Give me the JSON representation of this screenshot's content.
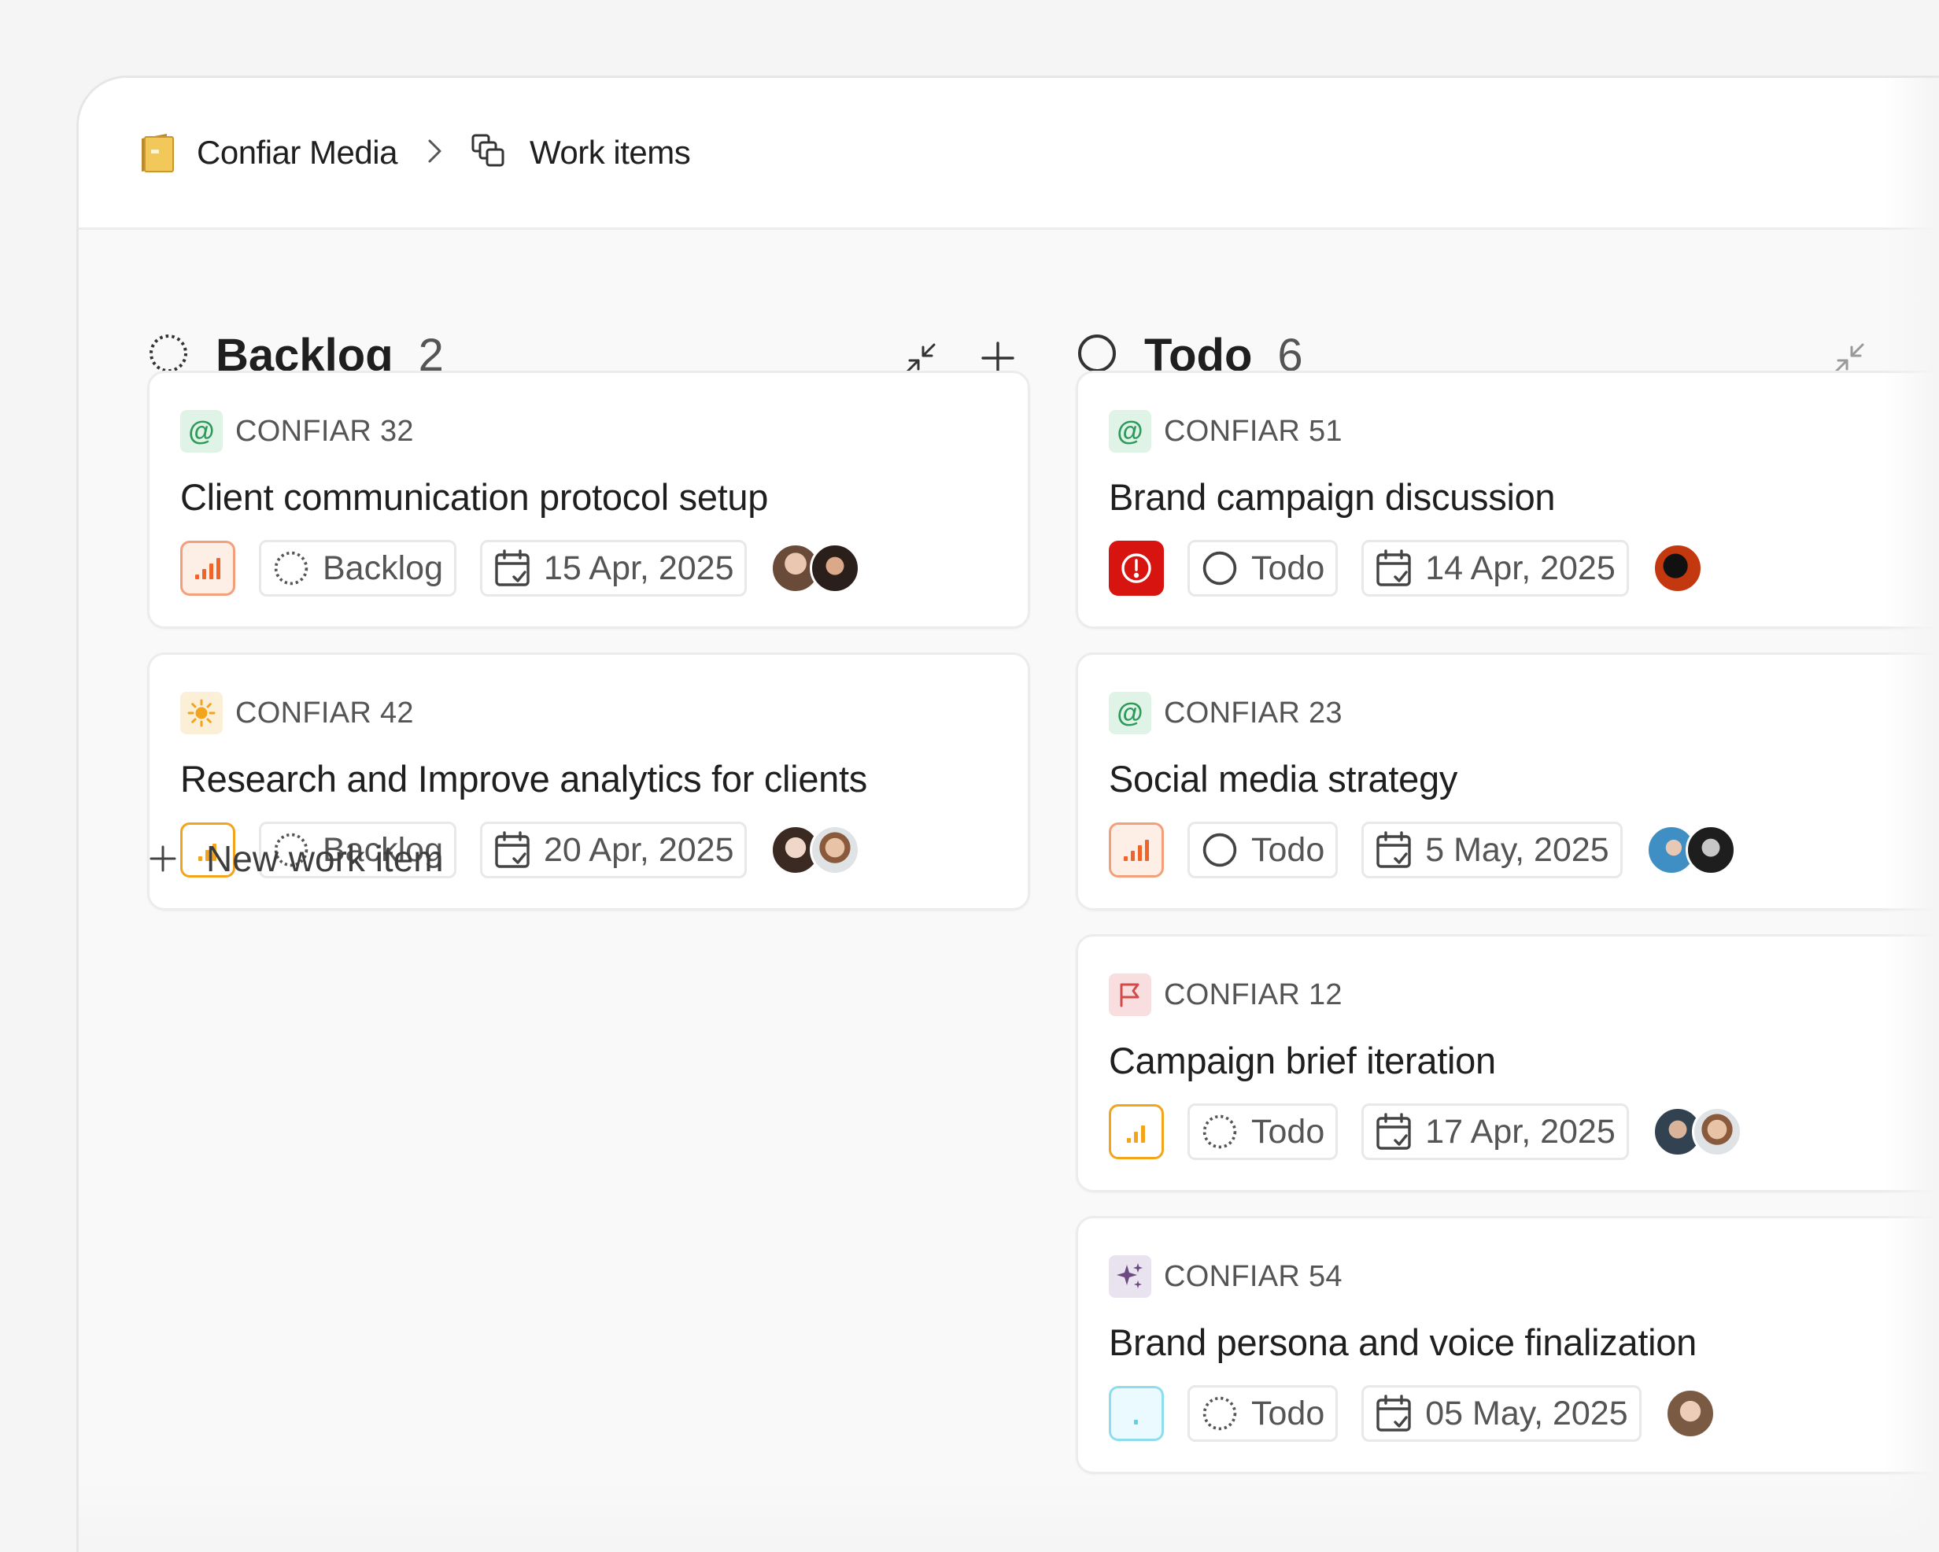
{
  "breadcrumb": {
    "project": "Confiar Media",
    "page": "Work items",
    "project_icon": "folder-icon",
    "page_icon": "layers-icon"
  },
  "columns": [
    {
      "title": "Backlog",
      "count": "2",
      "state_icon": "backlog-dashed-circle-icon",
      "cards": [
        {
          "id": "CONFIAR 32",
          "type": "at-sign",
          "title": "Client communication protocol setup",
          "priority": "high",
          "state": "Backlog",
          "date": "15 Apr, 2025",
          "assignees": 2
        },
        {
          "id": "CONFIAR 42",
          "type": "sun",
          "title": "Research and Improve analytics for clients",
          "priority": "medium",
          "state": "Backlog",
          "date": "20 Apr, 2025",
          "assignees": 2
        }
      ],
      "new_item_label": "New work item"
    },
    {
      "title": "Todo",
      "count": "6",
      "state_icon": "todo-circle-icon",
      "cards": [
        {
          "id": "CONFIAR 51",
          "type": "at-sign",
          "title": "Brand campaign discussion",
          "priority": "urgent",
          "state": "Todo",
          "date": "14 Apr, 2025",
          "assignees": 1
        },
        {
          "id": "CONFIAR 23",
          "type": "at-sign",
          "title": "Social media strategy",
          "priority": "high",
          "state": "Todo",
          "date": "5 May, 2025",
          "assignees": 2
        },
        {
          "id": "CONFIAR 12",
          "type": "flag",
          "title": "Campaign brief iteration",
          "priority": "medium",
          "state": "Todo",
          "date": "17 Apr, 2025",
          "assignees": 2
        },
        {
          "id": "CONFIAR 54",
          "type": "sparkle",
          "title": "Brand persona and voice finalization",
          "priority": "low",
          "state": "Todo",
          "date": "05 May, 2025",
          "assignees": 1
        }
      ]
    }
  ],
  "colors": {
    "priority_high": "#f0642a",
    "priority_medium": "#f2a41d",
    "priority_urgent": "#d81410",
    "priority_low": "#5fd0e6",
    "type_at_bg": "#dff3e6",
    "type_at_fg": "#2d9a5a",
    "type_sun_bg": "#fcefd8",
    "type_flag_bg": "#f8dede",
    "type_sparkle_bg": "#e9e2ef"
  }
}
